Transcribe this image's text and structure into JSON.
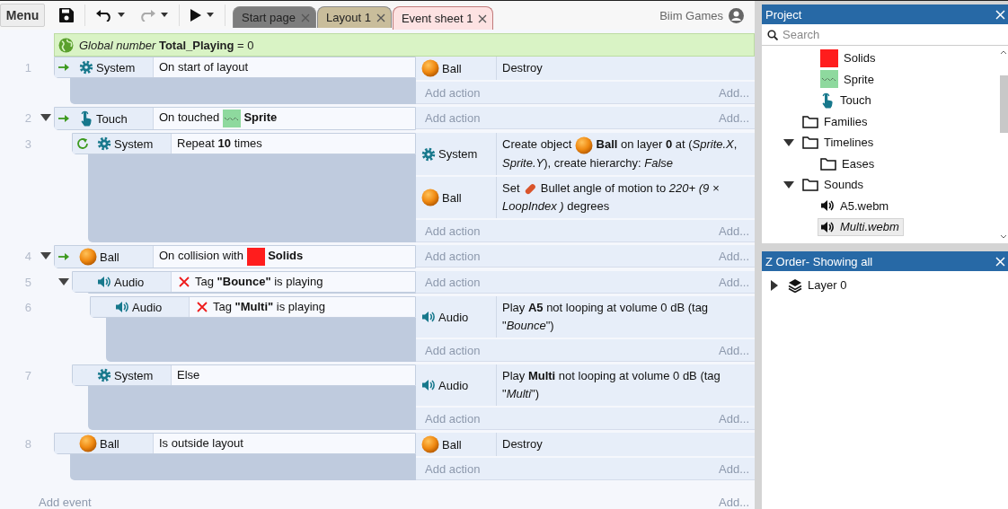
{
  "toolbar": {
    "menu": "Menu",
    "buttons": [
      {
        "kind": "save",
        "dropdown": false,
        "disabled": false
      },
      {
        "kind": "undo",
        "dropdown": true,
        "disabled": false
      },
      {
        "kind": "redo",
        "dropdown": true,
        "disabled": true
      },
      {
        "kind": "play",
        "dropdown": true,
        "disabled": false
      }
    ]
  },
  "tabs": [
    {
      "label": "Start page",
      "color": "#7d7d7d",
      "selected": false
    },
    {
      "label": "Layout 1",
      "color": "#c9bd9b",
      "selected": false
    },
    {
      "label": "Event sheet 1",
      "color": "#fde2e2",
      "selected": true
    }
  ],
  "user": "Biim Games",
  "global_variable": {
    "text": "*Global number* **Total_Playing** = 0"
  },
  "events": [
    {
      "number": "1",
      "conditions": [
        {
          "object": "System",
          "kind": "gear",
          "trigger": true,
          "loop": false,
          "inverted": false,
          "parts": [
            {
              "kind": "text",
              "text": "On start of layout"
            }
          ]
        }
      ],
      "actions": [
        {
          "object": "Ball",
          "kind": "ball",
          "parts": [
            {
              "kind": "text",
              "text": "Destroy"
            }
          ]
        }
      ],
      "add_action": "Add action",
      "add_more": "Add..."
    },
    {
      "number": "2",
      "expanded": true,
      "conditions": [
        {
          "object": "Touch",
          "kind": "touch",
          "trigger": true,
          "loop": false,
          "inverted": false,
          "parts": [
            {
              "kind": "text",
              "text": "On touched "
            },
            {
              "kind": "sprite"
            },
            {
              "kind": "text",
              "text": " **Sprite**"
            }
          ]
        }
      ],
      "add_action": "Add action",
      "add_more": "Add...",
      "children": [
        {
          "number": "3",
          "conditions": [
            {
              "object": "System",
              "kind": "gear",
              "trigger": false,
              "loop": true,
              "inverted": false,
              "parts": [
                {
                  "kind": "text",
                  "text": "Repeat **10** times"
                }
              ]
            }
          ],
          "actions": [
            {
              "object": "System",
              "kind": "gear",
              "parts": [
                {
                  "kind": "text",
                  "text": "Create object "
                },
                {
                  "kind": "ball"
                },
                {
                  "kind": "text",
                  "text": " **Ball** on layer **0** at (*Sprite.X*, *Sprite.Y*), create hierarchy: *False*"
                }
              ]
            },
            {
              "object": "Ball",
              "kind": "ball",
              "parts": [
                {
                  "kind": "text",
                  "text": "Set "
                },
                {
                  "kind": "bullet"
                },
                {
                  "kind": "text",
                  "text": " Bullet angle of motion to *220+ (9 × LoopIndex )* degrees"
                }
              ]
            }
          ],
          "add_action": "Add action",
          "add_more": "Add..."
        }
      ]
    },
    {
      "number": "4",
      "expanded": true,
      "conditions": [
        {
          "object": "Ball",
          "kind": "ball",
          "trigger": true,
          "loop": false,
          "inverted": false,
          "parts": [
            {
              "kind": "text",
              "text": "On collision with "
            },
            {
              "kind": "solids"
            },
            {
              "kind": "text",
              "text": " **Solids**"
            }
          ]
        }
      ],
      "add_action": "Add action",
      "add_more": "Add...",
      "children": [
        {
          "number": "5",
          "expanded": true,
          "conditions": [
            {
              "object": "Audio",
              "kind": "audio",
              "trigger": false,
              "loop": false,
              "inverted": true,
              "parts": [
                {
                  "kind": "text",
                  "text": "Tag **\"Bounce\"** is playing"
                }
              ]
            }
          ],
          "add_action": "Add action",
          "add_more": "Add...",
          "children": [
            {
              "number": "6",
              "conditions": [
                {
                  "object": "Audio",
                  "kind": "audio",
                  "trigger": false,
                  "loop": false,
                  "inverted": true,
                  "parts": [
                    {
                      "kind": "text",
                      "text": "Tag **\"Multi\"** is playing"
                    }
                  ]
                }
              ],
              "actions": [
                {
                  "object": "Audio",
                  "kind": "audio",
                  "parts": [
                    {
                      "kind": "text",
                      "text": "Play **A5** not looping at volume 0 dB (tag \"*Bounce*\")"
                    }
                  ]
                }
              ],
              "add_action": "Add action",
              "add_more": "Add..."
            }
          ]
        },
        {
          "number": "7",
          "conditions": [
            {
              "object": "System",
              "kind": "gear",
              "trigger": false,
              "loop": false,
              "inverted": false,
              "parts": [
                {
                  "kind": "text",
                  "text": "Else"
                }
              ]
            }
          ],
          "actions": [
            {
              "object": "Audio",
              "kind": "audio",
              "parts": [
                {
                  "kind": "text",
                  "text": "Play **Multi** not looping at volume 0 dB (tag \"*Multi*\")"
                }
              ]
            }
          ],
          "add_action": "Add action",
          "add_more": "Add..."
        }
      ]
    },
    {
      "number": "8",
      "conditions": [
        {
          "object": "Ball",
          "kind": "ball",
          "trigger": false,
          "loop": false,
          "inverted": false,
          "parts": [
            {
              "kind": "text",
              "text": "Is outside layout"
            }
          ]
        }
      ],
      "actions": [
        {
          "object": "Ball",
          "kind": "ball",
          "parts": [
            {
              "kind": "text",
              "text": "Destroy"
            }
          ]
        }
      ],
      "add_action": "Add action",
      "add_more": "Add..."
    }
  ],
  "add_event": {
    "label": "Add event",
    "more": "Add..."
  },
  "project_panel": {
    "title": "Project",
    "search": {
      "placeholder": "Search"
    },
    "tree": [
      {
        "children": [
          {
            "label": "Solids",
            "kind": "solids",
            "selected": false
          },
          {
            "label": "Sprite",
            "kind": "sprite",
            "selected": false
          },
          {
            "label": "Touch",
            "kind": "touch",
            "selected": false
          }
        ]
      },
      {
        "label": "Families",
        "kind": "folder",
        "selected": false
      },
      {
        "label": "Timelines",
        "kind": "folder",
        "expanded": true,
        "selected": false,
        "children": [
          {
            "label": "Eases",
            "kind": "folder",
            "selected": false
          }
        ]
      },
      {
        "label": "Sounds",
        "kind": "folder",
        "expanded": true,
        "selected": false,
        "children": [
          {
            "label": "A5.webm",
            "kind": "speaker",
            "selected": false
          },
          {
            "label": "Multi.webm",
            "kind": "speaker",
            "selected": true
          }
        ]
      }
    ]
  },
  "z_order_panel": {
    "title": "Z Order- Showing all",
    "tree": [
      {
        "label": "Layer 0",
        "kind": "layers",
        "expanded": false,
        "selected": false
      }
    ]
  }
}
